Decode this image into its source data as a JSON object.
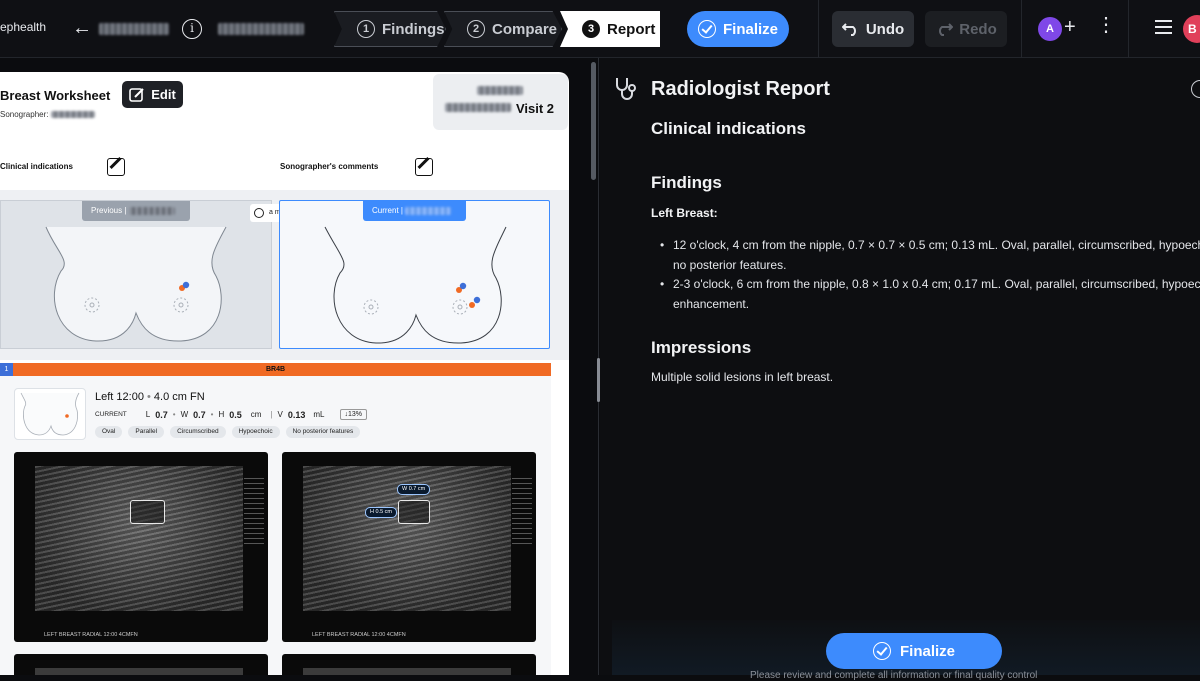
{
  "app": {
    "brand": "ephealth"
  },
  "header": {
    "steps": [
      {
        "num": "1",
        "label": "Findings"
      },
      {
        "num": "2",
        "label": "Compare"
      },
      {
        "num": "3",
        "label": "Report"
      }
    ],
    "finalize_label": "Finalize",
    "undo_label": "Undo",
    "redo_label": "Redo",
    "avatar_initial": "A",
    "avatar2_initial": "B",
    "plus_symbol": "+",
    "info_symbol": "i",
    "back_symbol": "←",
    "kebab_symbol": "⋮"
  },
  "worksheet": {
    "title": "Breast Worksheet",
    "edit_label": "Edit",
    "sonographer_label": "Sonographer:",
    "visit_label": "Visit 2",
    "clinical_indications_label": "Clinical indications",
    "sonographer_comments_label": "Sonographer's comments",
    "previous_label": "Previous",
    "current_label": "Current",
    "interval_label": "a month",
    "birads": "BR4B",
    "lesion_number": "1",
    "lesion": {
      "location": "Left 12:00",
      "distance": "4.0 cm FN",
      "current_label": "CURRENT",
      "l_label": "L",
      "l_value": "0.7",
      "w_label": "W",
      "w_value": "0.7",
      "h_label": "H",
      "h_value": "0.5",
      "unit": "cm",
      "v_label": "V",
      "v_value": "0.13",
      "v_unit": "mL",
      "delta": "↓13%",
      "features": [
        "Oval",
        "Parallel",
        "Circumscribed",
        "Hypoechoic",
        "No posterior features"
      ]
    },
    "images": [
      {
        "caption": "LEFT BREAST RADIAL 12:00 4CMFN",
        "measure_w": "",
        "measure_h": ""
      },
      {
        "caption": "LEFT BREAST RADIAL 12:00 4CMFN",
        "measure_w": "W 0.7 cm",
        "measure_h": "H 0.5 cm"
      }
    ]
  },
  "report": {
    "title": "Radiologist Report",
    "clinical_indications_heading": "Clinical indications",
    "findings_heading": "Findings",
    "left_breast_label": "Left Breast:",
    "findings": [
      "12 o'clock, 4 cm from the nipple, 0.7 × 0.7 × 0.5 cm; 0.13 mL. Oval, parallel, circumscribed, hypoechoic, no posterior features.",
      "2-3 o'clock, 6 cm from the nipple, 0.8 × 1.0 x 0.4 cm; 0.17 mL. Oval, parallel, circumscribed, hypoechoic, enhancement."
    ],
    "impressions_heading": "Impressions",
    "impressions_text": "Multiple solid lesions in left breast.",
    "finalize_label": "Finalize",
    "footer_note": "Please review and complete all information or final quality control"
  },
  "colors": {
    "accent": "#3d8bfd",
    "birads": "#f06a24",
    "avatar": "#7f48e8"
  }
}
